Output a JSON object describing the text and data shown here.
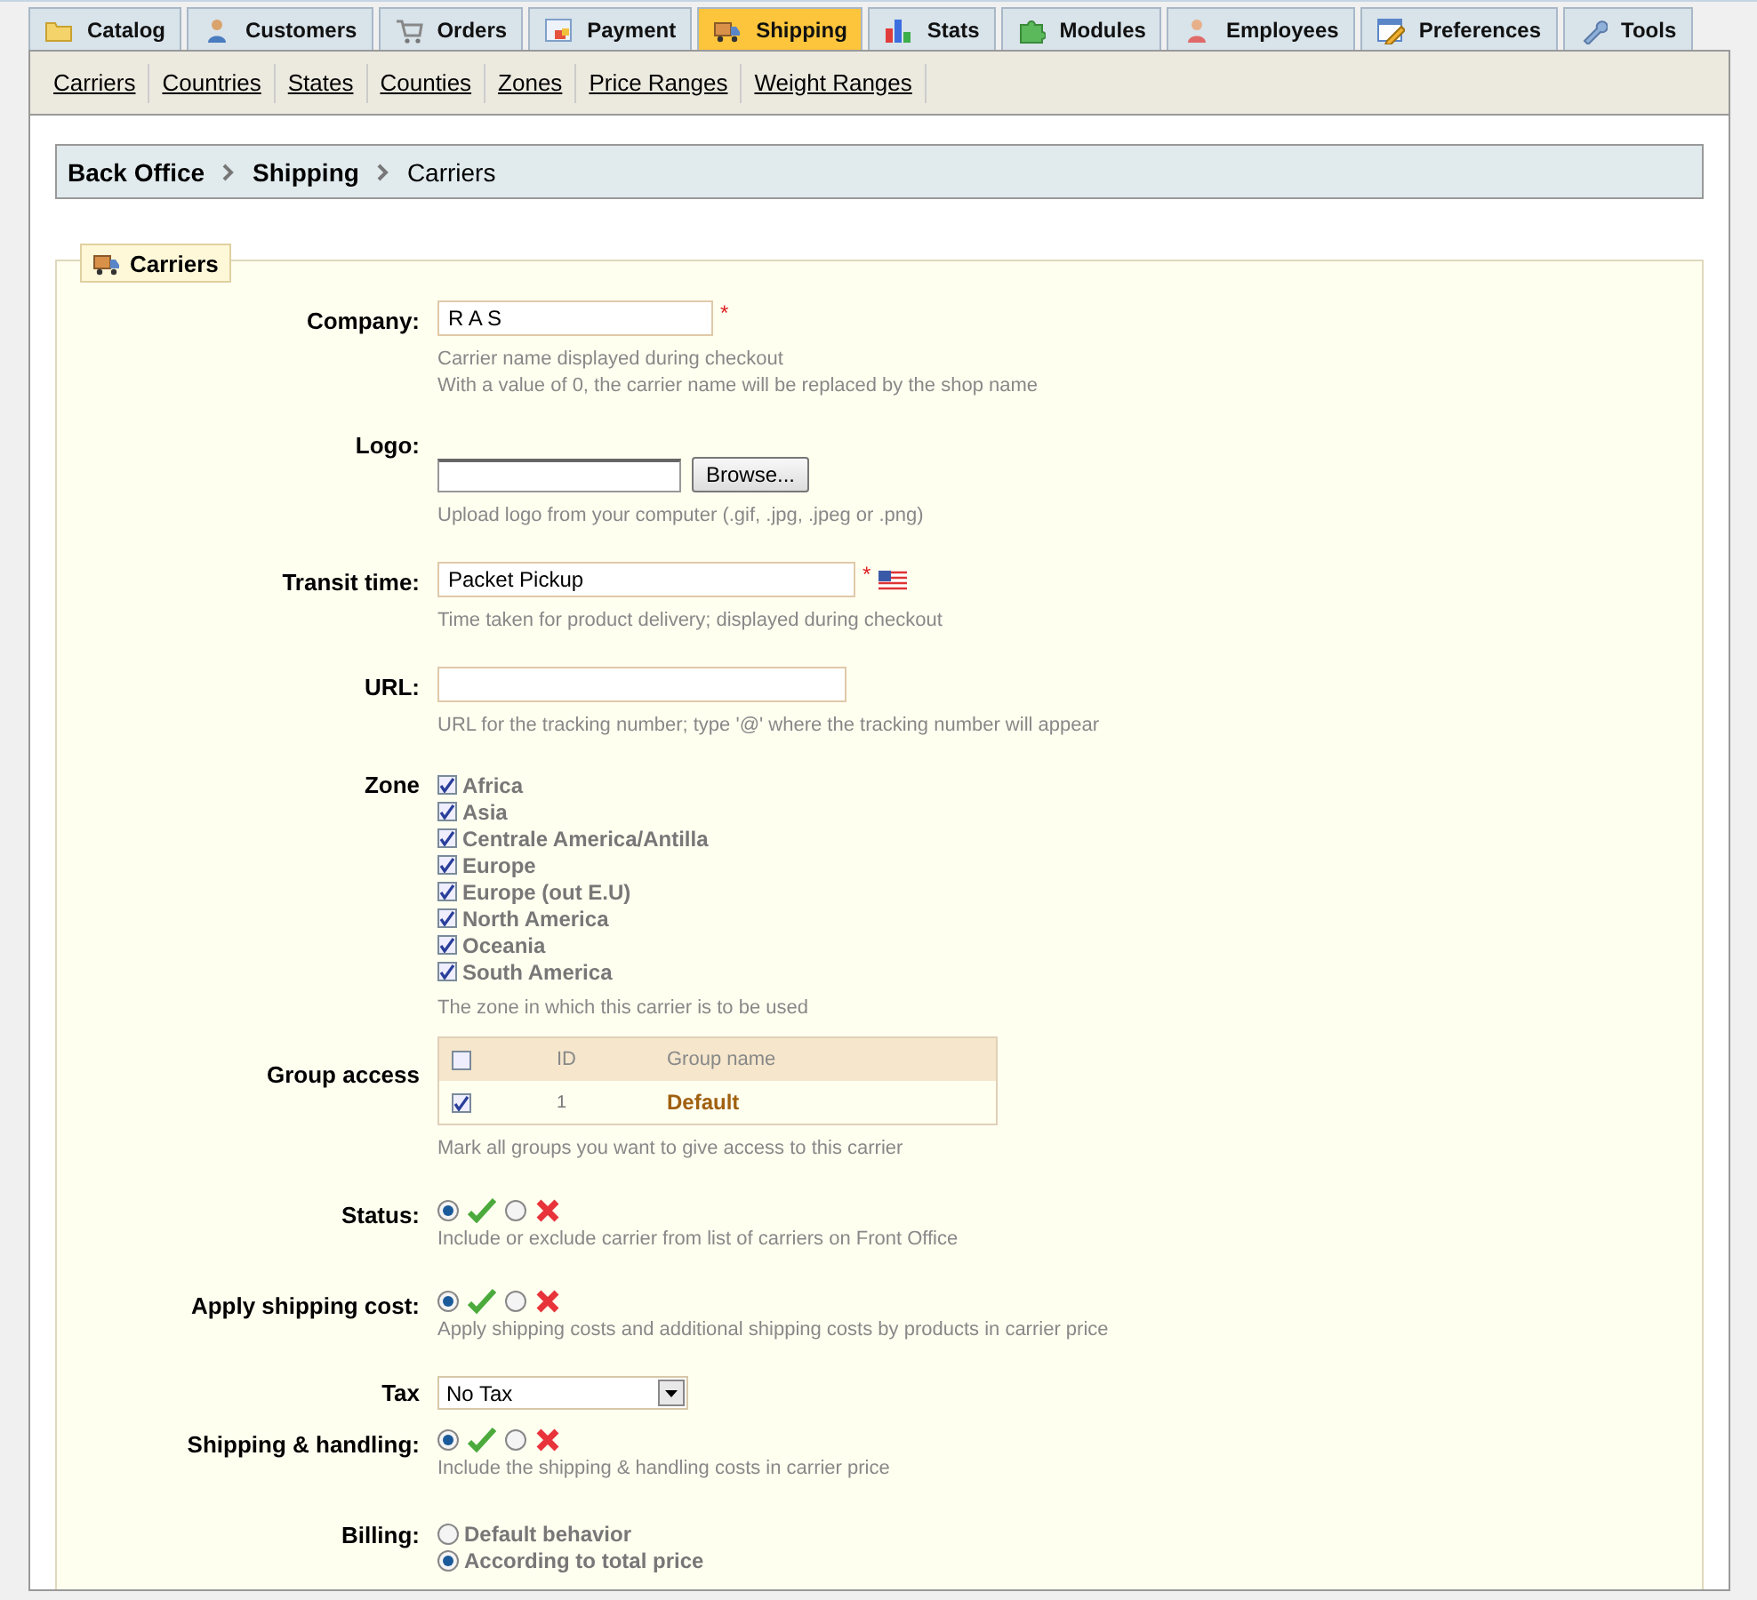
{
  "tabs": [
    {
      "label": "Catalog",
      "selected": false
    },
    {
      "label": "Customers",
      "selected": false
    },
    {
      "label": "Orders",
      "selected": false
    },
    {
      "label": "Payment",
      "selected": false
    },
    {
      "label": "Shipping",
      "selected": true
    },
    {
      "label": "Stats",
      "selected": false
    },
    {
      "label": "Modules",
      "selected": false
    },
    {
      "label": "Employees",
      "selected": false
    },
    {
      "label": "Preferences",
      "selected": false
    },
    {
      "label": "Tools",
      "selected": false
    }
  ],
  "subnav": [
    "Carriers",
    "Countries",
    "States",
    "Counties",
    "Zones",
    "Price Ranges",
    "Weight Ranges"
  ],
  "breadcrumb": [
    "Back Office",
    "Shipping",
    "Carriers"
  ],
  "form": {
    "legend": "Carriers",
    "fields": [
      {
        "kind": "text",
        "label": "Company:",
        "value": "R A S",
        "required_mark": "*",
        "hints": [
          "Carrier name displayed during checkout",
          "With a value of 0, the carrier name will be replaced by the shop name"
        ]
      },
      {
        "kind": "file",
        "label": "Logo:",
        "button": "Browse...",
        "hints": [
          "Upload logo from your computer (.gif, .jpg, .jpeg or .png)"
        ]
      },
      {
        "kind": "text",
        "label": "Transit time:",
        "value": "Packet Pickup",
        "required_mark": "*",
        "translatable": true,
        "hints": [
          "Time taken for product delivery; displayed during checkout"
        ]
      },
      {
        "kind": "text",
        "label": "URL:",
        "hints": [
          "URL for the tracking number; type '@' where the tracking number will appear"
        ]
      },
      {
        "kind": "checklist",
        "label": "Zone",
        "options": [
          {
            "label": "Africa",
            "checked": true
          },
          {
            "label": "Asia",
            "checked": true
          },
          {
            "label": "Centrale America/Antilla",
            "checked": true
          },
          {
            "label": "Europe",
            "checked": true
          },
          {
            "label": "Europe (out E.U)",
            "checked": true
          },
          {
            "label": "North America",
            "checked": true
          },
          {
            "label": "Oceania",
            "checked": true
          },
          {
            "label": "South America",
            "checked": true
          }
        ],
        "hints": [
          "The zone in which this carrier is to be used"
        ]
      },
      {
        "kind": "table",
        "label": "Group access",
        "all_checked": false,
        "columns": [
          "ID",
          "Group name"
        ],
        "rows": [
          {
            "checked": true,
            "id": "1",
            "name": "Default"
          }
        ],
        "hints": [
          "Mark all groups you want to give access to this carrier"
        ]
      },
      {
        "kind": "toggle",
        "label": "Status:",
        "on": true,
        "hints": [
          "Include or exclude carrier from list of carriers on Front Office"
        ]
      },
      {
        "kind": "toggle",
        "label": "Apply shipping cost:",
        "on": true,
        "hints": [
          "Apply shipping costs and additional shipping costs by products in carrier price"
        ]
      },
      {
        "kind": "select",
        "label": "Tax",
        "value": "No Tax"
      },
      {
        "kind": "toggle",
        "label": "Shipping & handling:",
        "on": true,
        "hints": [
          "Include the shipping & handling costs in carrier price"
        ]
      },
      {
        "kind": "radios",
        "label": "Billing:",
        "options": [
          {
            "label": "Default behavior",
            "selected": false
          },
          {
            "label": "According to total price",
            "selected": true
          }
        ]
      }
    ]
  }
}
